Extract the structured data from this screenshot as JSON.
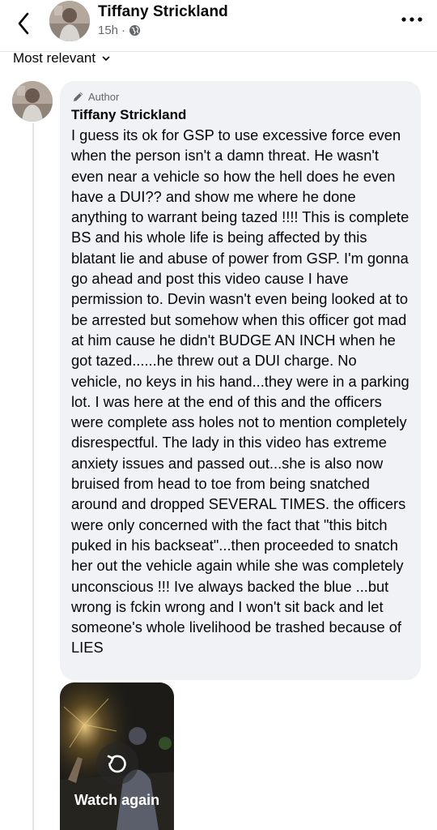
{
  "header": {
    "name": "Tiffany Strickland",
    "time": "15h",
    "separator": "·",
    "privacy_icon": "globe-icon",
    "back_icon": "chevron-left-icon",
    "more_icon": "more-horizontal-icon"
  },
  "sort": {
    "label": "Most relevant",
    "icon": "chevron-down-icon"
  },
  "comment": {
    "badge": "Author",
    "badge_icon": "pencil-icon",
    "author": "Tiffany Strickland",
    "text": "I guess its ok for GSP to use excessive force even when the person isn't a damn threat. He wasn't even near a vehicle so how the hell does he even have a DUI?? and show me where he done anything to warrant being tazed !!!! This is complete BS and his whole life is being affected by this blatant lie and abuse of power from GSP. I'm gonna go ahead and post this video cause I have permission to. Devin wasn't even being looked at to be arrested but somehow when this officer got mad at him cause he didn't BUDGE AN INCH when he got tazed......he threw out a DUI charge. No vehicle, no keys in his hand...they were in a parking lot. I was here at the end of this and the officers were complete ass holes not to mention completely disrespectful. The lady in this video has extreme anxiety issues and passed out...she is also now bruised from head to toe from being snatched around and dropped SEVERAL TIMES. the officers were only concerned with the fact that \"this bitch puked in his backseat\"...then proceeded to snatch her out the vehicle again while she was completely unconscious !!! Ive always backed the blue ...but wrong is fckin wrong and I won't sit back and let someone's whole livelihood be trashed because of LIES"
  },
  "video": {
    "label": "Watch again",
    "icon": "replay-icon"
  },
  "colors": {
    "bubble_bg": "#f0f2f5",
    "secondary_text": "#65676b",
    "divider": "#e4e6eb"
  }
}
